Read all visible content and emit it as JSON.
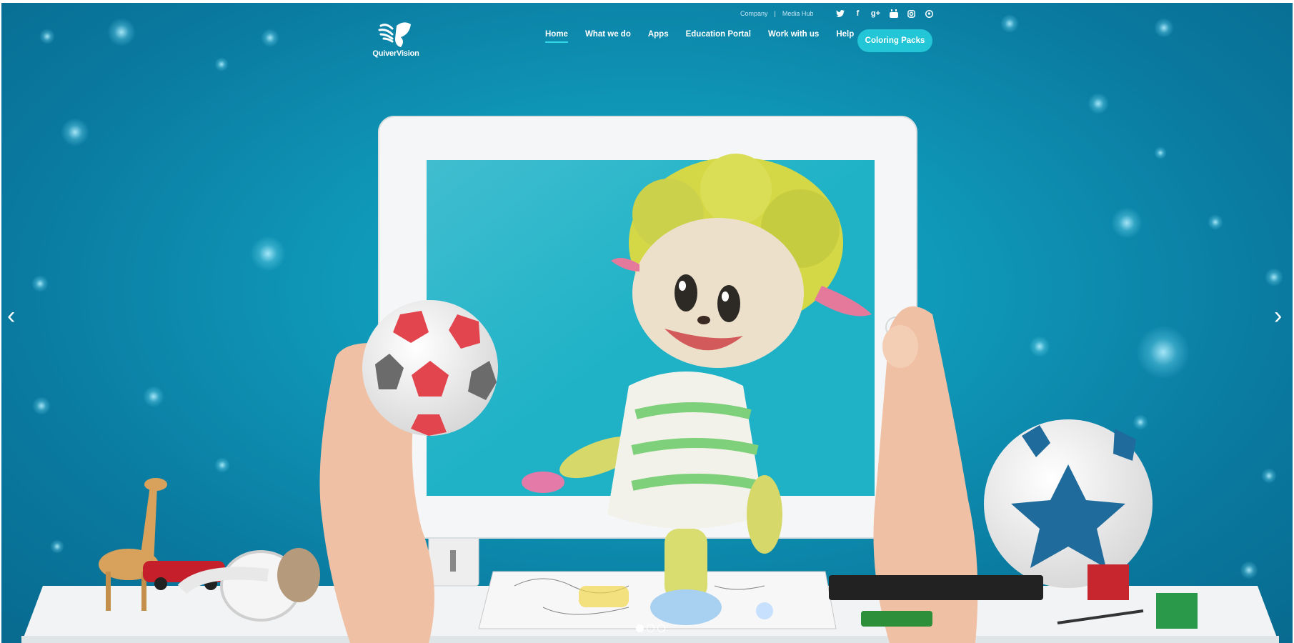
{
  "header": {
    "logo_text": "QuiverVision",
    "top_links": [
      "Company",
      "Media Hub"
    ],
    "top_separator": "|",
    "social_icons": [
      "twitter-icon",
      "facebook-icon",
      "google-plus-icon",
      "youtube-icon",
      "instagram-icon",
      "pinterest-icon"
    ],
    "social_glyphs": [
      "🐦",
      "f",
      "g+",
      "▶",
      "◘",
      "℗"
    ],
    "nav": [
      {
        "label": "Home",
        "active": true
      },
      {
        "label": "What we do"
      },
      {
        "label": "Apps"
      },
      {
        "label": "Education Portal"
      },
      {
        "label": "Work with us"
      },
      {
        "label": "Help"
      }
    ],
    "cta_label": "Coloring Packs"
  },
  "carousel": {
    "prev_glyph": "‹",
    "next_glyph": "›",
    "slide_count": 3,
    "active_slide": 1
  },
  "colors": {
    "background": "#0f97b7",
    "accent": "#22c6d6",
    "nav_underline": "#35d8e6"
  }
}
